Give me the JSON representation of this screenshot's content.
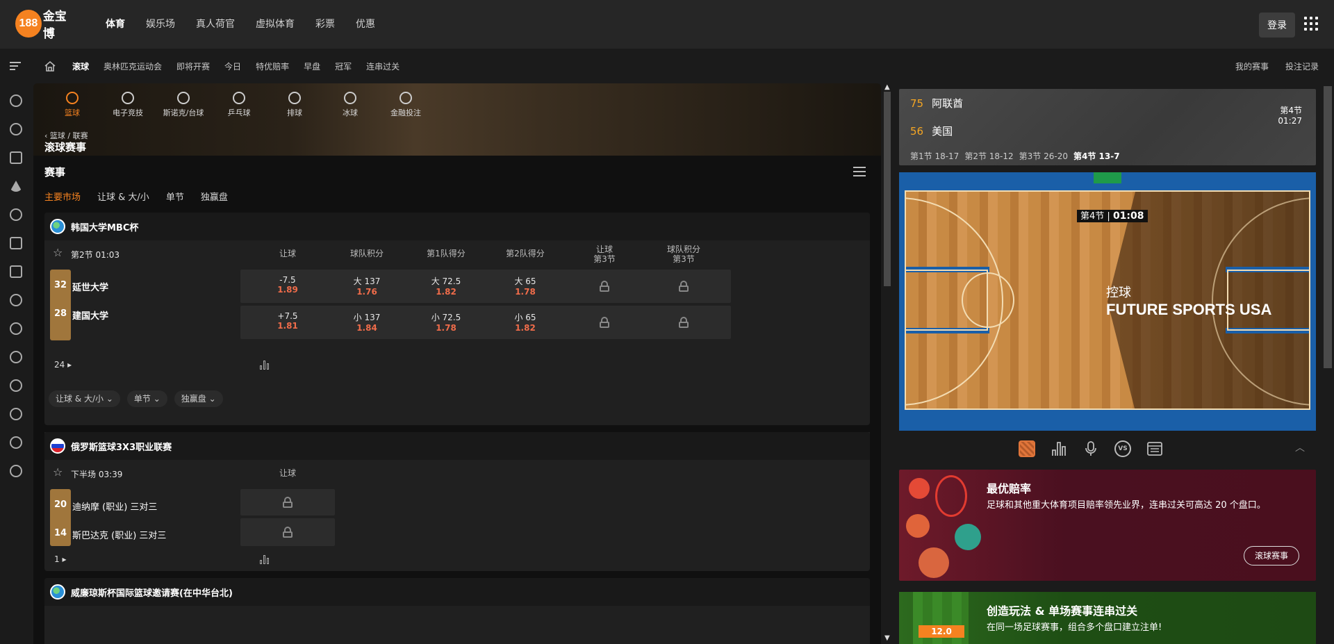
{
  "brand": {
    "badge": "188",
    "name": "金宝博",
    "accent": "#f58220"
  },
  "topnav": {
    "items": [
      "体育",
      "娱乐场",
      "真人荷官",
      "虚拟体育",
      "彩票",
      "优惠"
    ],
    "login": "登录"
  },
  "subnav": {
    "items": [
      "滚球",
      "奥林匹克运动会",
      "即将开赛",
      "今日",
      "特优赔率",
      "早盘",
      "冠军",
      "连串过关"
    ],
    "right": [
      "我的赛事",
      "投注记录"
    ]
  },
  "sport_tabs": [
    "篮球",
    "电子竞技",
    "斯诺克/台球",
    "乒乓球",
    "排球",
    "冰球",
    "金融投注"
  ],
  "hero": {
    "breadcrumb": "篮球 / 联赛",
    "title": "滚球赛事"
  },
  "section": {
    "title": "赛事",
    "market_tabs": [
      "主要市场",
      "让球 & 大/小",
      "单节",
      "独赢盘"
    ]
  },
  "leagues": [
    {
      "name": "韩国大学MBC杯",
      "period": "第2节 01:03",
      "columns": [
        "让球",
        "球队积分",
        "第1队得分",
        "第2队得分",
        "让球\n第3节",
        "球队积分\n第3节"
      ],
      "teams": [
        {
          "score": "32",
          "name": "延世大学",
          "odds": [
            [
              "-7.5",
              "1.89"
            ],
            [
              "大 137",
              "1.76"
            ],
            [
              "大 72.5",
              "1.82"
            ],
            [
              "大 65",
              "1.78"
            ]
          ]
        },
        {
          "score": "28",
          "name": "建国大学",
          "odds": [
            [
              "+7.5",
              "1.81"
            ],
            [
              "小 137",
              "1.84"
            ],
            [
              "小 72.5",
              "1.78"
            ],
            [
              "小 65",
              "1.82"
            ]
          ]
        }
      ],
      "more": "24",
      "chips": [
        "让球 & 大/小",
        "单节",
        "独赢盘"
      ]
    },
    {
      "name": "俄罗斯篮球3X3职业联赛",
      "period": "下半场 03:39",
      "columns": [
        "让球"
      ],
      "teams": [
        {
          "score": "20",
          "name": "迪纳摩 (职业) 三对三"
        },
        {
          "score": "14",
          "name": "斯巴达克 (职业) 三对三"
        }
      ],
      "more": "1"
    },
    {
      "name": "威廉琼斯杯国际篮球邀请赛(在中华台北)"
    }
  ],
  "scoreboard": {
    "home": {
      "score": "75",
      "name": "阿联酋"
    },
    "away": {
      "score": "56",
      "name": "美国"
    },
    "quarter": "第4节",
    "clock": "01:27",
    "periods": [
      "第1节 18-17",
      "第2节 18-12",
      "第3节 26-20",
      "第4节 13-7"
    ]
  },
  "court": {
    "quarter": "第4节",
    "clock": "01:08",
    "action": "控球",
    "team": "FUTURE SPORTS USA"
  },
  "tools": [
    "court-icon",
    "stats-icon",
    "mic-icon",
    "vs-icon",
    "scoreboard-icon"
  ],
  "promos": [
    {
      "title": "最优赔率",
      "desc": "足球和其他重大体育项目赔率领先业界，连串过关可高达 20 个盘口。",
      "button": "滚球赛事"
    },
    {
      "title": "创造玩法 & 单场赛事连串过关",
      "desc": "在同一场足球赛事，组合多个盘口建立注单!",
      "odds_tag": "12.0"
    }
  ]
}
